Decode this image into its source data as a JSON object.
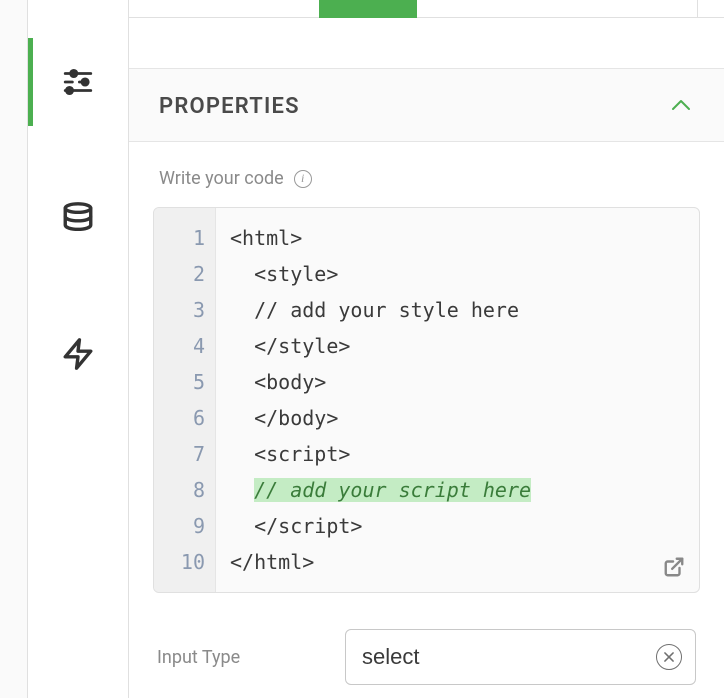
{
  "panel": {
    "title": "PROPERTIES",
    "subheader": "Write your code"
  },
  "code": {
    "lines": [
      "<html>",
      "  <style>",
      "  // add your style here",
      "  </style>",
      "  <body>",
      "  </body>",
      "  <script>",
      "  // add your script here",
      "  </script>",
      "</html>"
    ],
    "highlighted_line_index": 7
  },
  "input_type": {
    "label": "Input Type",
    "value": "select"
  },
  "sidebar": {
    "items": [
      {
        "name": "settings",
        "active": true
      },
      {
        "name": "database",
        "active": false
      },
      {
        "name": "actions",
        "active": false
      }
    ]
  }
}
